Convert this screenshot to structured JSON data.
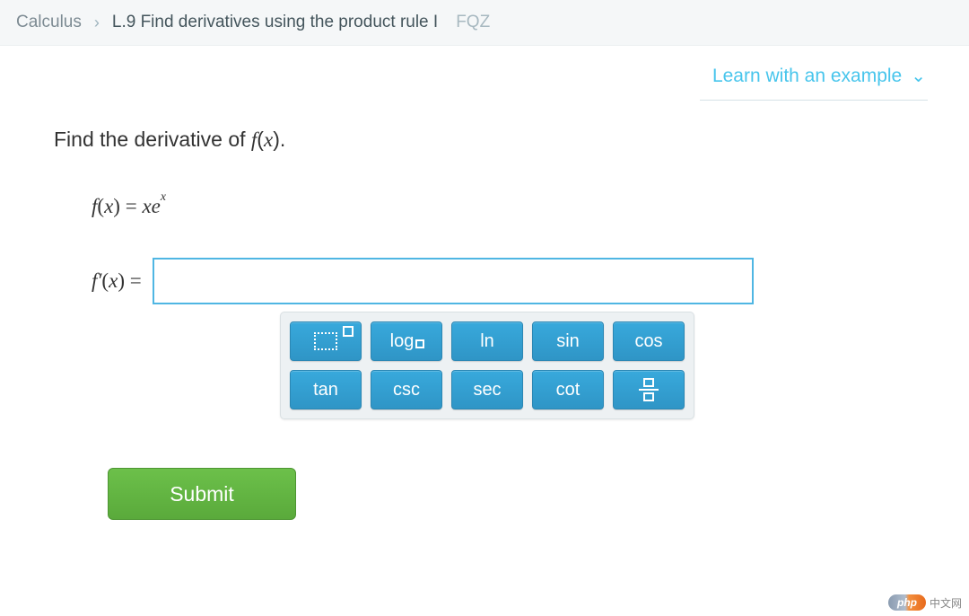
{
  "breadcrumb": {
    "course": "Calculus",
    "skill": "L.9 Find derivatives using the product rule I",
    "code": "FQZ"
  },
  "learn_link": "Learn with an example",
  "prompt": {
    "prefix": "Find the derivative of ",
    "fn": "f",
    "var": "x",
    "suffix": "."
  },
  "equation": {
    "fn": "f",
    "var": "x",
    "eq": "=",
    "rhs_coeff": "x",
    "rhs_base": "e",
    "rhs_exp": "x"
  },
  "answer": {
    "label_fn": "f′",
    "label_var": "x",
    "label_eq": "=",
    "value": ""
  },
  "keypad": {
    "rows": [
      [
        "exp",
        "log",
        "ln",
        "sin",
        "cos"
      ],
      [
        "tan",
        "csc",
        "sec",
        "cot",
        "frac"
      ]
    ],
    "labels": {
      "log": "log",
      "ln": "ln",
      "sin": "sin",
      "cos": "cos",
      "tan": "tan",
      "csc": "csc",
      "sec": "sec",
      "cot": "cot"
    }
  },
  "submit": "Submit",
  "badge": {
    "pill": "php",
    "text": "中文网"
  }
}
